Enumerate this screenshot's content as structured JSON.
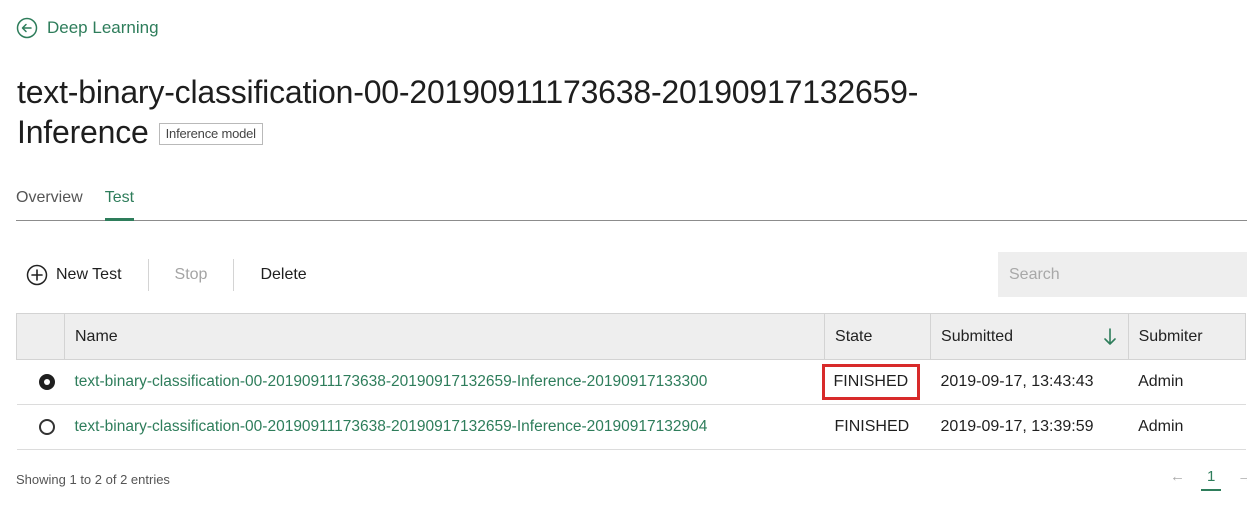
{
  "back_link": {
    "label": "Deep Learning"
  },
  "title": {
    "line1": "text-binary-classification-00-20190911173638-20190917132659-",
    "line2": "Inference",
    "badge": "Inference model"
  },
  "tabs": [
    {
      "label": "Overview",
      "active": false
    },
    {
      "label": "Test",
      "active": true
    }
  ],
  "toolbar": {
    "new_test": "New Test",
    "stop": "Stop",
    "delete": "Delete",
    "search_placeholder": "Search"
  },
  "table": {
    "headers": {
      "name": "Name",
      "state": "State",
      "submitted": "Submitted",
      "submitter": "Submiter"
    },
    "rows": [
      {
        "selected": true,
        "name": "text-binary-classification-00-20190911173638-20190917132659-Inference-20190917133300",
        "state": "FINISHED",
        "submitted": "2019-09-17, 13:43:43",
        "submitter": "Admin"
      },
      {
        "selected": false,
        "name": "text-binary-classification-00-20190911173638-20190917132659-Inference-20190917132904",
        "state": "FINISHED",
        "submitted": "2019-09-17, 13:39:59",
        "submitter": "Admin"
      }
    ]
  },
  "footer": {
    "entries": "Showing 1 to 2 of 2 entries",
    "prev": "←",
    "page": "1",
    "next": "→"
  },
  "colors": {
    "accent": "#2e7d5b",
    "highlight": "#d82a2a"
  }
}
